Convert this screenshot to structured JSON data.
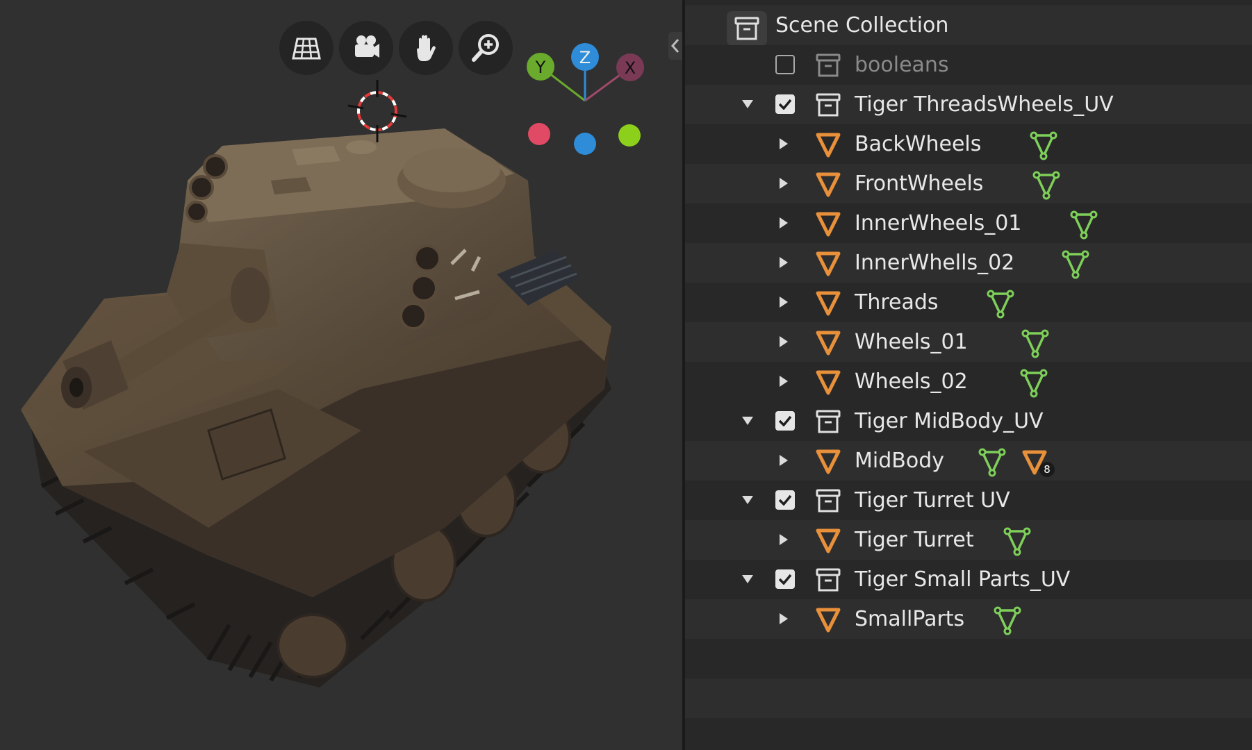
{
  "viewport": {
    "nav_buttons": [
      {
        "name": "toggle-camera-view",
        "icon": "grid-perspective-icon"
      },
      {
        "name": "camera-view",
        "icon": "camera-icon"
      },
      {
        "name": "pan-view",
        "icon": "hand-icon"
      },
      {
        "name": "zoom-view",
        "icon": "zoom-icon"
      }
    ],
    "gizmo": {
      "y": "Y",
      "z": "Z",
      "x": "X"
    },
    "colors": {
      "x": "#e14a64",
      "y": "#6aaa2c",
      "z": "#2e8cd8",
      "neg_x": "#7a3a55"
    }
  },
  "outliner": {
    "scene_collection": "Scene Collection",
    "items": [
      {
        "type": "collection",
        "label": "booleans",
        "checked": false,
        "dim": true
      },
      {
        "type": "collection",
        "label": "Tiger ThreadsWheels_UV",
        "checked": true,
        "expanded": true
      },
      {
        "type": "object",
        "label": "BackWheels"
      },
      {
        "type": "object",
        "label": "FrontWheels"
      },
      {
        "type": "object",
        "label": "InnerWheels_01"
      },
      {
        "type": "object",
        "label": "InnerWhells_02"
      },
      {
        "type": "object",
        "label": "Threads"
      },
      {
        "type": "object",
        "label": "Wheels_01"
      },
      {
        "type": "object",
        "label": "Wheels_02"
      },
      {
        "type": "collection",
        "label": "Tiger MidBody_UV",
        "checked": true,
        "expanded": true
      },
      {
        "type": "object",
        "label": "MidBody",
        "modifier_count": "8"
      },
      {
        "type": "collection",
        "label": "Tiger Turret UV",
        "checked": true,
        "expanded": true
      },
      {
        "type": "object",
        "label": "Tiger Turret"
      },
      {
        "type": "collection",
        "label": "Tiger Small Parts_UV",
        "checked": true,
        "expanded": true
      },
      {
        "type": "object",
        "label": "SmallParts"
      }
    ],
    "colors": {
      "object_orange": "#e8903a",
      "mesh_green": "#7ed05a"
    }
  }
}
